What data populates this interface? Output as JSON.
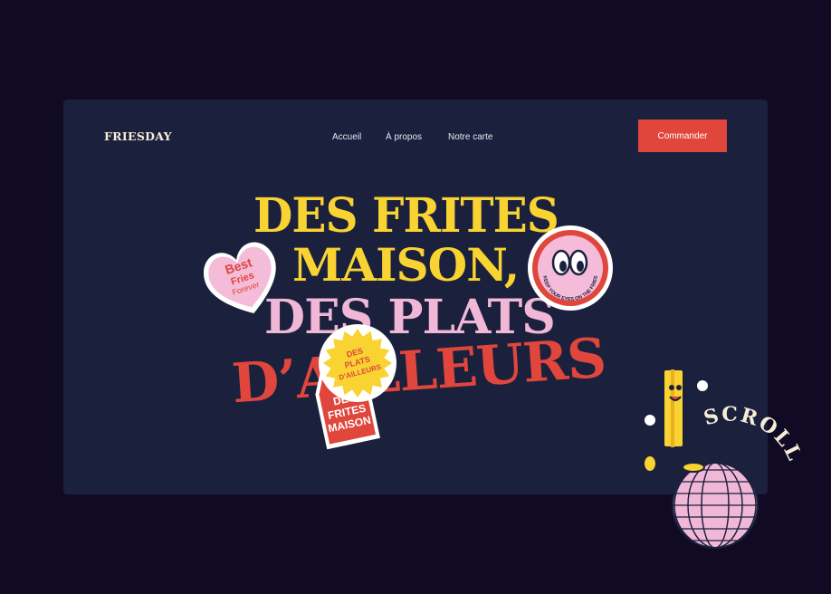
{
  "brand": {
    "logo": "FRIESDAY"
  },
  "nav": {
    "items": [
      {
        "label": "Accueil"
      },
      {
        "label": "À propos"
      },
      {
        "label": "Notre carte"
      }
    ]
  },
  "cta": {
    "label": "Commander"
  },
  "hero": {
    "line1": "DES FRITES",
    "line2": "MAISON,",
    "line3": "DES PLATS",
    "line4": "D’AILLEURS"
  },
  "stickers": {
    "heart": {
      "l1": "Best",
      "l2": "Fries",
      "l3": "Forever"
    },
    "eyes": {
      "text": "KEEP YOUR EYES ON THE FRIES"
    },
    "sun": {
      "l1": "DES",
      "l2": "PLATS",
      "l3": "D’AILLEURS"
    },
    "tag": {
      "l1": "DES",
      "l2": "FRITES",
      "l3": "MAISON"
    }
  },
  "scroll": {
    "label": "SCROLL"
  },
  "colors": {
    "background": "#110a24",
    "card": "#1b213d",
    "yellow": "#f8d332",
    "pink": "#f1b7d6",
    "red": "#e0463c"
  }
}
